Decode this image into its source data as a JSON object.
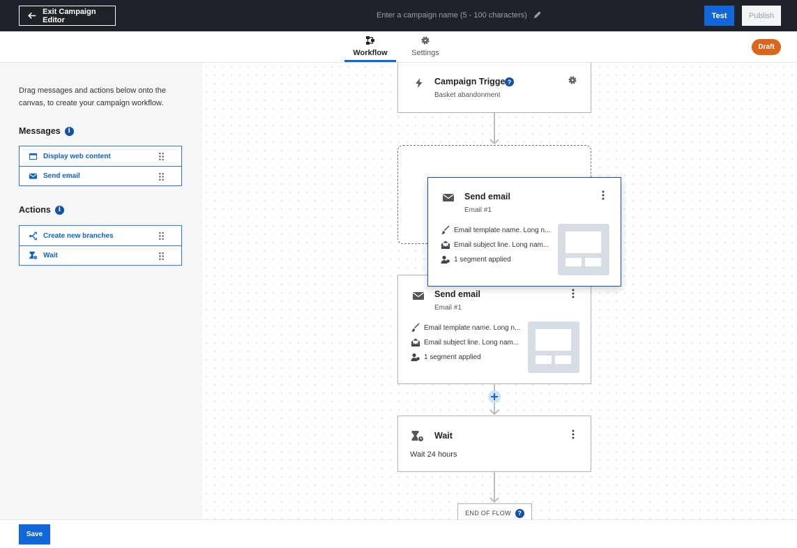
{
  "header": {
    "exit_label": "Exit Campaign Editor",
    "campaign_name_placeholder": "Enter a campaign name (5 - 100 characters)",
    "test_label": "Test",
    "publish_label": "Publish"
  },
  "tabs": [
    {
      "label": "Workflow",
      "icon": "workflow-icon",
      "active": true
    },
    {
      "label": "Settings",
      "icon": "gear-icon",
      "active": false
    }
  ],
  "status_badge": "Draft",
  "sidebar": {
    "intro": "Drag messages and actions below onto the canvas, to create your campaign workflow.",
    "messages_title": "Messages",
    "messages": [
      {
        "label": "Display web content",
        "icon": "browser-window-icon"
      },
      {
        "label": "Send email",
        "icon": "envelope-icon"
      }
    ],
    "actions_title": "Actions",
    "actions": [
      {
        "label": "Create new branches",
        "icon": "branch-icon"
      },
      {
        "label": "Wait",
        "icon": "hourglass-icon"
      }
    ]
  },
  "canvas": {
    "trigger": {
      "title": "Campaign Trigger",
      "subtitle": "Basket abandonment"
    },
    "dragging_card": {
      "title": "Send email",
      "subtitle": "Email #1",
      "template": "Email template name. Long n...",
      "subject": "Email subject line. Long nam...",
      "segments": "1 segment applied"
    },
    "email_card": {
      "title": "Send email",
      "subtitle": "Email #1",
      "template": "Email template name. Long n...",
      "subject": "Email subject line. Long nam...",
      "segments": "1 segment applied"
    },
    "wait_card": {
      "title": "Wait",
      "detail": "Wait 24 hours"
    },
    "end_flow": "END OF FLOW"
  },
  "footer": {
    "save_label": "Save"
  },
  "colors": {
    "primary": "#1166d8",
    "draft": "#d9661a",
    "topbar": "#1f2329",
    "info": "#1152a8"
  }
}
